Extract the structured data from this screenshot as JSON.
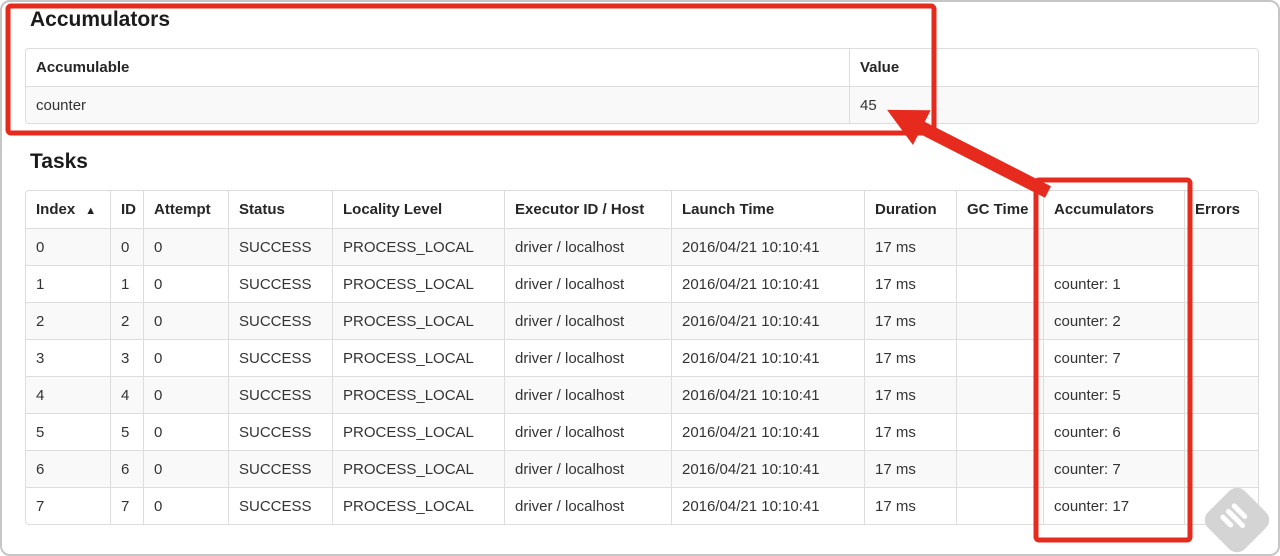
{
  "accumulators_section": {
    "title": "Accumulators",
    "table": {
      "headers": [
        "Accumulable",
        "Value"
      ],
      "rows": [
        {
          "accumulable": "counter",
          "value": "45"
        }
      ]
    }
  },
  "tasks_section": {
    "title": "Tasks",
    "table": {
      "headers": [
        "Index",
        "ID",
        "Attempt",
        "Status",
        "Locality Level",
        "Executor ID / Host",
        "Launch Time",
        "Duration",
        "GC Time",
        "Accumulators",
        "Errors"
      ],
      "sort": {
        "column": "Index",
        "direction": "ascending",
        "indicator": "▲"
      },
      "rows": [
        {
          "index": "0",
          "id": "0",
          "attempt": "0",
          "status": "SUCCESS",
          "locality_level": "PROCESS_LOCAL",
          "executor_id_host": "driver / localhost",
          "launch_time": "2016/04/21 10:10:41",
          "duration": "17 ms",
          "gc_time": "",
          "accumulators": "",
          "errors": ""
        },
        {
          "index": "1",
          "id": "1",
          "attempt": "0",
          "status": "SUCCESS",
          "locality_level": "PROCESS_LOCAL",
          "executor_id_host": "driver / localhost",
          "launch_time": "2016/04/21 10:10:41",
          "duration": "17 ms",
          "gc_time": "",
          "accumulators": "counter: 1",
          "errors": ""
        },
        {
          "index": "2",
          "id": "2",
          "attempt": "0",
          "status": "SUCCESS",
          "locality_level": "PROCESS_LOCAL",
          "executor_id_host": "driver / localhost",
          "launch_time": "2016/04/21 10:10:41",
          "duration": "17 ms",
          "gc_time": "",
          "accumulators": "counter: 2",
          "errors": ""
        },
        {
          "index": "3",
          "id": "3",
          "attempt": "0",
          "status": "SUCCESS",
          "locality_level": "PROCESS_LOCAL",
          "executor_id_host": "driver / localhost",
          "launch_time": "2016/04/21 10:10:41",
          "duration": "17 ms",
          "gc_time": "",
          "accumulators": "counter: 7",
          "errors": ""
        },
        {
          "index": "4",
          "id": "4",
          "attempt": "0",
          "status": "SUCCESS",
          "locality_level": "PROCESS_LOCAL",
          "executor_id_host": "driver / localhost",
          "launch_time": "2016/04/21 10:10:41",
          "duration": "17 ms",
          "gc_time": "",
          "accumulators": "counter: 5",
          "errors": ""
        },
        {
          "index": "5",
          "id": "5",
          "attempt": "0",
          "status": "SUCCESS",
          "locality_level": "PROCESS_LOCAL",
          "executor_id_host": "driver / localhost",
          "launch_time": "2016/04/21 10:10:41",
          "duration": "17 ms",
          "gc_time": "",
          "accumulators": "counter: 6",
          "errors": ""
        },
        {
          "index": "6",
          "id": "6",
          "attempt": "0",
          "status": "SUCCESS",
          "locality_level": "PROCESS_LOCAL",
          "executor_id_host": "driver / localhost",
          "launch_time": "2016/04/21 10:10:41",
          "duration": "17 ms",
          "gc_time": "",
          "accumulators": "counter: 7",
          "errors": ""
        },
        {
          "index": "7",
          "id": "7",
          "attempt": "0",
          "status": "SUCCESS",
          "locality_level": "PROCESS_LOCAL",
          "executor_id_host": "driver / localhost",
          "launch_time": "2016/04/21 10:10:41",
          "duration": "17 ms",
          "gc_time": "",
          "accumulators": "counter: 17",
          "errors": ""
        }
      ]
    }
  },
  "annotations": {
    "color": "#e62b1e",
    "items": [
      "accumulators-section-box",
      "accumulators-column-box",
      "arrow-to-value-45"
    ]
  },
  "watermark": {
    "icon": "feedly-logo",
    "color": "#d4d4d4"
  }
}
